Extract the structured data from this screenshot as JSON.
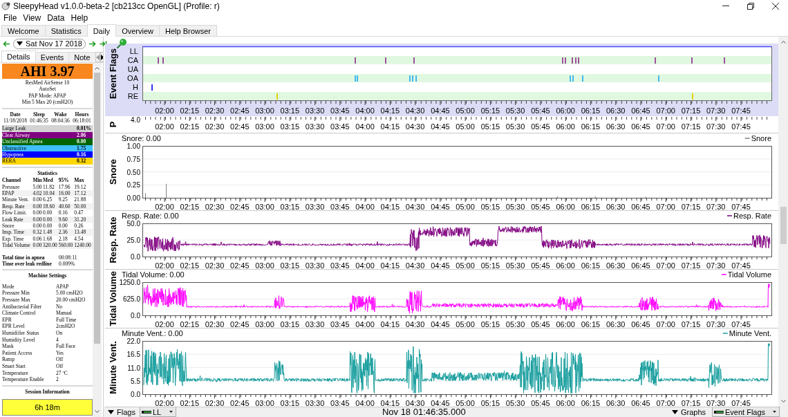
{
  "window": {
    "title": "SleepyHead v1.0.0-beta-2 [cb213cc OpenGL] (Profile: r)"
  },
  "menu": [
    "File",
    "View",
    "Data",
    "Help"
  ],
  "tabs": [
    {
      "label": "Welcome",
      "selected": false
    },
    {
      "label": "Statistics",
      "selected": false
    },
    {
      "label": "Daily",
      "selected": true
    },
    {
      "label": "Overview",
      "selected": false
    },
    {
      "label": "Help Browser",
      "selected": false
    }
  ],
  "date_nav": {
    "date": "Sat Nov 17 2018"
  },
  "side_tabs": [
    {
      "label": "Details",
      "selected": true
    },
    {
      "label": "Events",
      "selected": false
    },
    {
      "label": "Note",
      "selected": false
    }
  ],
  "summary": {
    "ahi": "AHI 3.97",
    "device": [
      "ResMed AirSense 10",
      "AutoSet",
      "PAP Mode: APAP",
      "Min 5 Max 20 (cmH2O)"
    ]
  },
  "session_times": {
    "columns": [
      "Date",
      "Sleep",
      "Wake",
      "Hours"
    ],
    "values": [
      "11/18/2018",
      "01:46:35",
      "08:04:36",
      "06:18:01"
    ]
  },
  "event_indices": [
    {
      "label": "Large Leak",
      "value": "0.01%",
      "color": "#d3d3d3"
    },
    {
      "label": "Clear Airway",
      "value": "2.06",
      "color": "#800080"
    },
    {
      "label": "Unclassified Apnea",
      "value": "0.00",
      "color": "#006400"
    },
    {
      "label": "Obstructive",
      "value": "1.75",
      "color": "#40c0ff"
    },
    {
      "label": "Hypopnea",
      "value": "0.16",
      "color": "#0000ff"
    },
    {
      "label": "RERA",
      "value": "0.32",
      "color": "#ffd700"
    }
  ],
  "statistics": {
    "title": "Statistics",
    "columns": [
      "Channel",
      "Min",
      "Med",
      "95%",
      "Max"
    ],
    "rows": [
      [
        "Pressure",
        "5.00",
        "11.82",
        "17.96",
        "19.12"
      ],
      [
        "EPAP",
        "4.02",
        "10.04",
        "16.00",
        "17.12"
      ],
      [
        "Minute Vent.",
        "0.00",
        "6.25",
        "9.25",
        "21.88"
      ],
      [
        "Resp. Rate",
        "0.00",
        "18.60",
        "40.60",
        "50.00"
      ],
      [
        "Flow Limit.",
        "0.00",
        "0.00",
        "0.16",
        "0.47"
      ],
      [
        "Leak Rate",
        "0.00",
        "0.00",
        "9.60",
        "31.20"
      ],
      [
        "Snore",
        "0.00",
        "0.00",
        "0.00",
        "0.26"
      ],
      [
        "Insp. Time",
        "0.32",
        "1.48",
        "2.36",
        "13.48"
      ],
      [
        "Exp. Time",
        "0.06",
        "1.68",
        "2.18",
        "4.54"
      ],
      [
        "Tidal Volume",
        "0.00",
        "320.00",
        "560.00",
        "1240.00"
      ]
    ]
  },
  "totals": [
    {
      "label": "Total time in apnea",
      "value": "00:08:11"
    },
    {
      "label": "Time over leak redline",
      "value": "0.009%"
    }
  ],
  "machine_settings": {
    "title": "Machine Settings",
    "rows": [
      [
        "Mode",
        "APAP"
      ],
      [
        "Pressure Min",
        "5.00 cmH2O"
      ],
      [
        "Pressure Max",
        "20.00 cmH2O"
      ],
      [
        "Antibacterial Filter",
        "No"
      ],
      [
        "Climate Control",
        "Manual"
      ],
      [
        "EPR",
        "Full Time"
      ],
      [
        "EPR Level",
        "2cmH2O"
      ],
      [
        "Humidifier Status",
        "On"
      ],
      [
        "Humidity Level",
        "4"
      ],
      [
        "Mask",
        "Full Face"
      ],
      [
        "Patient Access",
        "Yes"
      ],
      [
        "Ramp",
        "Off"
      ],
      [
        "Smart Start",
        "Off"
      ],
      [
        "Temperature",
        "27 ºC"
      ],
      [
        "Temperature Enable",
        "2"
      ]
    ]
  },
  "session_information": {
    "title": "Session Information",
    "duration": "6h 18m"
  },
  "graphs": [
    {
      "kind": "flags",
      "title": "Event Flags",
      "rows": [
        {
          "label": "LL"
        },
        {
          "label": "CA",
          "color": "#a0509c"
        },
        {
          "label": "UA"
        },
        {
          "label": "OA",
          "color": "#40b8f0"
        },
        {
          "label": "H",
          "color": "#3030f0"
        },
        {
          "label": "RE",
          "color": "#e0d000"
        }
      ],
      "xticks": [
        "02:00",
        "02:15",
        "02:30",
        "02:45",
        "03:00",
        "03:15",
        "03:30",
        "03:45",
        "04:00",
        "04:15",
        "04:30",
        "04:45",
        "05:00",
        "05:15",
        "05:30",
        "05:45",
        "06:00",
        "06:15",
        "06:30",
        "06:45",
        "07:00",
        "07:15",
        "07:30",
        "07:45"
      ]
    },
    {
      "kind": "partial",
      "title": "P",
      "yticks": [
        "4.0"
      ],
      "xticks": [
        "02:00",
        "02:15",
        "02:30",
        "02:45",
        "03:00",
        "03:15",
        "03:30",
        "03:45",
        "04:00",
        "04:15",
        "04:30",
        "04:45",
        "05:00",
        "05:15",
        "05:30",
        "05:45",
        "06:00",
        "06:15",
        "06:30",
        "06:45",
        "07:00",
        "07:15",
        "07:30",
        "07:45"
      ]
    },
    {
      "kind": "spikes",
      "title": "Snore",
      "readout": "Snore: 0.00",
      "legend": "Snore",
      "color": "#808080",
      "yticks": [
        "1.00",
        "0.75",
        "0.50",
        "0.25",
        "0.00"
      ],
      "xticks": [
        "02:00",
        "02:15",
        "02:30",
        "02:45",
        "03:00",
        "03:15",
        "03:30",
        "03:45",
        "04:00",
        "04:15",
        "04:30",
        "04:45",
        "05:00",
        "05:15",
        "05:30",
        "05:45",
        "06:00",
        "06:15",
        "06:30",
        "06:45",
        "07:00",
        "07:15",
        "07:30",
        "07:45"
      ]
    },
    {
      "kind": "line",
      "title": "Resp. Rate",
      "readout": "Resp. Rate: 0.00",
      "legend": "Resp. Rate",
      "color": "#800080",
      "yticks": [
        "50.0",
        "25.0",
        "0.0"
      ],
      "xticks": [
        "02:00",
        "02:15",
        "02:30",
        "02:45",
        "03:00",
        "03:15",
        "03:30",
        "03:45",
        "04:00",
        "04:15",
        "04:30",
        "04:45",
        "05:00",
        "05:15",
        "05:30",
        "05:45",
        "06:00",
        "06:15",
        "06:30",
        "06:45",
        "07:00",
        "07:15",
        "07:30",
        "07:45"
      ]
    },
    {
      "kind": "line",
      "title": "Tidal Volume",
      "readout": "Tidal Volume: 0.00",
      "legend": "Tidal Volume",
      "color": "#ff00ff",
      "yticks": [
        "1250.0",
        "625.0",
        "0.0"
      ],
      "xticks": [
        "02:00",
        "02:15",
        "02:30",
        "02:45",
        "03:00",
        "03:15",
        "03:30",
        "03:45",
        "04:00",
        "04:15",
        "04:30",
        "04:45",
        "05:00",
        "05:15",
        "05:30",
        "05:45",
        "06:00",
        "06:15",
        "06:30",
        "06:45",
        "07:00",
        "07:15",
        "07:30",
        "07:45"
      ]
    },
    {
      "kind": "line",
      "title": "Minute Vent.",
      "readout": "Minute Vent.: 0.00",
      "legend": "Minute Vent.",
      "color": "#139c9c",
      "yticks": [
        "22.0",
        "16.5",
        "11.0",
        "5.5",
        "0.0"
      ],
      "xticks": [
        "02:00",
        "02:15",
        "02:30",
        "02:45",
        "03:00",
        "03:15",
        "03:30",
        "03:45",
        "04:00",
        "04:15",
        "04:30",
        "04:45",
        "05:00",
        "05:15",
        "05:30",
        "05:45",
        "06:00",
        "06:15",
        "06:30",
        "06:45",
        "07:00",
        "07:15",
        "07:30",
        "07:45"
      ]
    }
  ],
  "bottom_bar": {
    "flags_button": "Flags",
    "flag_select": "LL",
    "position": "Nov 18 01:46:35.000",
    "graphs_button": "Graphs",
    "graph_select": "Event Flags"
  }
}
